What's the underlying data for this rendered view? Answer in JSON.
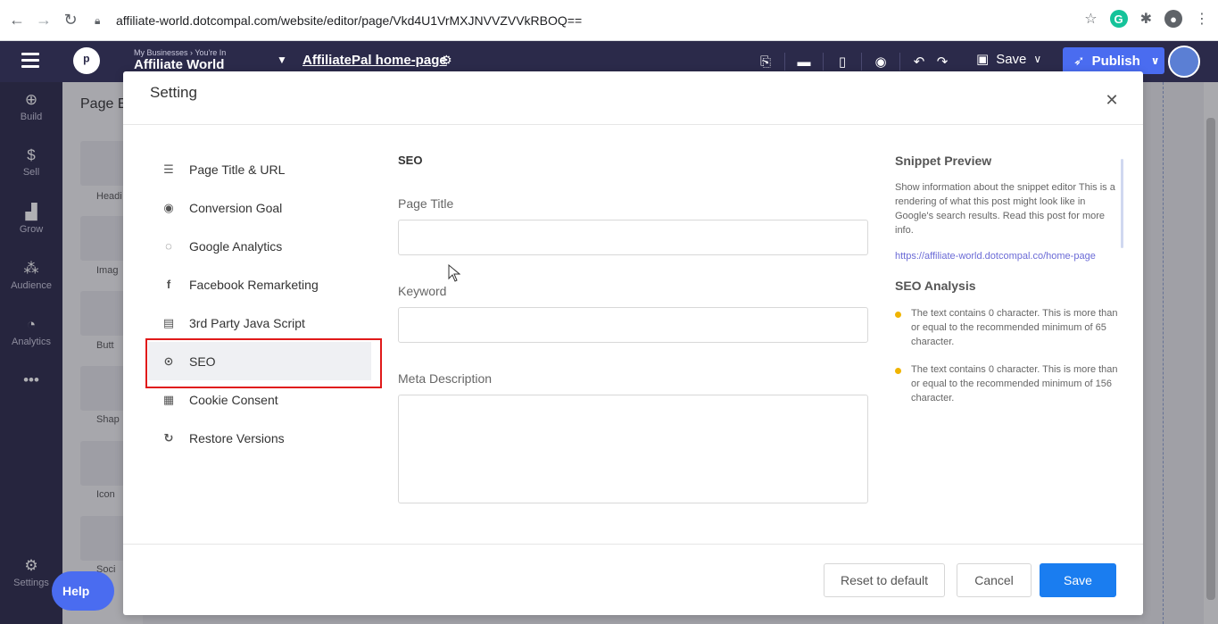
{
  "browser": {
    "url": "affiliate-world.dotcompal.com/website/editor/page/Vkd4U1VrMXJNVVZVVkRBOQ==",
    "back_icon": "back-arrow-icon",
    "forward_icon": "forward-arrow-icon",
    "reload_icon": "reload-icon",
    "star_icon": "star-icon"
  },
  "topbar": {
    "business_crumb": "My Businesses › You're In",
    "business_name": "Affiliate World",
    "page_name": "AffiliatePal home-page",
    "save_label": "Save",
    "publish_label": "Publish"
  },
  "sidebar": {
    "items": [
      {
        "icon": "⊕",
        "label": "Build"
      },
      {
        "icon": "$",
        "label": "Sell"
      },
      {
        "icon": "▟",
        "label": "Grow"
      },
      {
        "icon": "⁂",
        "label": "Audience"
      },
      {
        "icon": "◔",
        "label": "Analytics"
      },
      {
        "icon": "•••",
        "label": ""
      }
    ],
    "settings_label": "Settings",
    "help_label": "Help"
  },
  "background_panel": {
    "title": "Page E",
    "labels": [
      "Headi",
      "Imag",
      "Butt",
      "Shap",
      "Icon",
      "Soci"
    ]
  },
  "modal": {
    "title": "Setting",
    "menu": [
      {
        "icon": "☰",
        "label": "Page Title & URL"
      },
      {
        "icon": "◉",
        "label": "Conversion Goal"
      },
      {
        "icon": "◌",
        "label": "Google Analytics"
      },
      {
        "icon": "f",
        "label": "Facebook Remarketing"
      },
      {
        "icon": "▤",
        "label": "3rd Party Java Script"
      },
      {
        "icon": "⊙",
        "label": "SEO"
      },
      {
        "icon": "▦",
        "label": "Cookie Consent"
      },
      {
        "icon": "↻",
        "label": "Restore Versions"
      }
    ],
    "active_menu": "SEO",
    "form": {
      "section_title": "SEO",
      "page_title_label": "Page Title",
      "page_title_value": "",
      "keyword_label": "Keyword",
      "keyword_value": "",
      "meta_label": "Meta Description",
      "meta_value": ""
    },
    "snippet": {
      "title": "Snippet Preview",
      "description": "Show information about the snippet editor This is a rendering of what this post might look like in Google's search results. Read this post for more info.",
      "url": "https://affiliate-world.dotcompal.co/home-page",
      "analysis_title": "SEO Analysis",
      "analysis": [
        "The text contains 0 character. This is more than or equal to the recommended minimum of 65 character.",
        "The text contains 0 character. This is more than or equal to the recommended minimum of 156 character."
      ],
      "bullet_color": "#f0b400"
    },
    "buttons": {
      "reset": "Reset to default",
      "cancel": "Cancel",
      "save": "Save"
    }
  },
  "colors": {
    "app_bar": "#2b2a4a",
    "primary": "#1a7df0",
    "publish": "#4a6cf0",
    "highlight": "#e01a1a"
  }
}
